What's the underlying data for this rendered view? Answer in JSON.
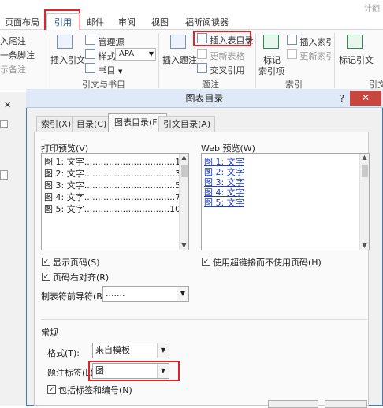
{
  "ribbon": {
    "app_title": "计翻",
    "tabs": [
      "页面布局",
      "引用",
      "邮件",
      "审阅",
      "视图",
      "福昕阅读器"
    ],
    "footnotes": {
      "insert_endnote": "入尾注",
      "next_footnote": "一条脚注",
      "show_notes": "示备注"
    },
    "citations": {
      "insert_citation": "插入引文",
      "manage_sources": "管理源",
      "style_label": "样式:",
      "style_value": "APA",
      "bibliography": "书目",
      "group_name": "引文与书目"
    },
    "captions": {
      "insert_caption": "插入题注",
      "insert_table_of_figures": "插入表目录",
      "update_table": "更新表格",
      "cross_reference": "交叉引用",
      "group_name": "题注"
    },
    "index": {
      "mark_entry": "标记",
      "mark_entry_2": "索引项",
      "insert_index": "插入索引",
      "update_index": "更新索引",
      "group_name": "索引"
    },
    "authorities": {
      "mark_citation": "标记引文",
      "group_name": "引文"
    }
  },
  "dialog": {
    "title": "图表目录",
    "help": "?",
    "close": "✕",
    "tabs": [
      "索引(X)",
      "目录(C)",
      "图表目录(F)",
      "引文目录(A)"
    ],
    "print_preview_label": "打印预览(V)",
    "print_preview_lines": [
      "图 1: 文字.................................1",
      "图 2: 文字.................................3",
      "图 3: 文字.................................5",
      "图 4: 文字.................................7",
      "图 5: 文字...............................10"
    ],
    "web_preview_label": "Web 预览(W)",
    "web_preview_lines": [
      "图 1: 文字",
      "图 2: 文字",
      "图 3: 文字",
      "图 4: 文字",
      "图 5: 文字"
    ],
    "show_page_numbers": "显示页码(S)",
    "right_align_page_numbers": "页码右对齐(R)",
    "tab_leader_label": "制表符前导符(B):",
    "tab_leader_value": ".......",
    "use_hyperlinks": "使用超链接而不使用页码(H)",
    "general_label": "常规",
    "formats_label": "格式(T):",
    "formats_value": "来自模板",
    "caption_label_label": "题注标签(L):",
    "caption_label_value": "图",
    "include_label_number": "包括标签和编号(N)",
    "check_mark": "✓"
  }
}
